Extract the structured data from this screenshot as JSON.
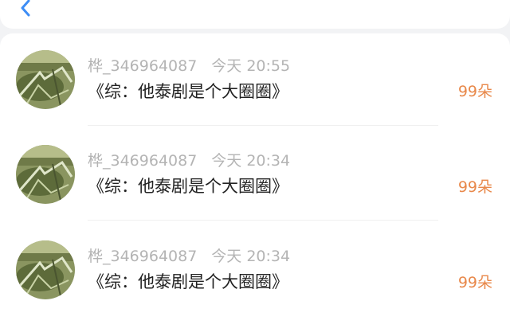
{
  "header": {
    "back_icon": "chevron-left-icon",
    "accent_color": "#3d8df5"
  },
  "items": [
    {
      "username": "桦_346964087",
      "time": "今天 20:55",
      "title": "《综：他泰剧是个大圈圈》",
      "reward": "99朵"
    },
    {
      "username": "桦_346964087",
      "time": "今天 20:34",
      "title": "《综：他泰剧是个大圈圈》",
      "reward": "99朵"
    },
    {
      "username": "桦_346964087",
      "time": "今天 20:34",
      "title": "《综：他泰剧是个大圈圈》",
      "reward": "99朵"
    }
  ],
  "colors": {
    "reward": "#e8884a",
    "meta_text": "#b4b4b4",
    "title_text": "#222222"
  }
}
